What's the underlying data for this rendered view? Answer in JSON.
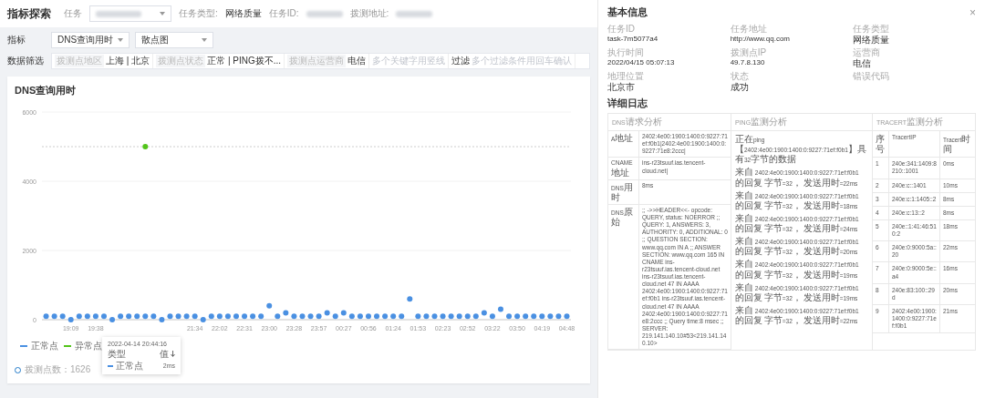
{
  "header": {
    "title": "指标探索",
    "task_label": "任务",
    "task_type_label": "任务类型:",
    "task_type": "网络质量",
    "task_id_label": "任务ID:",
    "address_label": "拨测地址:"
  },
  "metric": {
    "label": "指标",
    "metric_value": "DNS查询用时",
    "chart_type": "散点图"
  },
  "filter": {
    "label": "数据筛选",
    "items": [
      {
        "label": "拨测点地区",
        "value": "上海 | 北京"
      },
      {
        "label": "拨测点状态",
        "value": "正常 | PING拨不..."
      },
      {
        "label": "拨测点运营商",
        "value": "电信"
      },
      {
        "placeholder": "多个关键字用竖线"
      },
      {
        "label": "过滤",
        "placeholder": "多个过滤条件用回车确认"
      }
    ]
  },
  "chart": {
    "title": "DNS查询用时",
    "footer": "拨测点数：1626",
    "tooltip": {
      "time": "2022-04-14 20:44:16",
      "column_1": "类型",
      "column_2": "值",
      "rows": [
        {
          "name": "正常点",
          "value": "2ms",
          "color": "#4a90e2"
        }
      ]
    },
    "chart_data": {
      "type": "scatter",
      "categories": [
        null,
        null,
        null,
        "19:09",
        null,
        null,
        "19:38",
        null,
        null,
        null,
        null,
        null,
        null,
        null,
        null,
        null,
        null,
        null,
        "21:34",
        null,
        null,
        "22:02",
        null,
        null,
        "22:31",
        null,
        null,
        "23:00",
        null,
        null,
        "23:28",
        null,
        null,
        "23:57",
        null,
        null,
        "00:27",
        null,
        null,
        "00:56",
        null,
        null,
        "01:24",
        null,
        null,
        "01:53",
        null,
        null,
        "02:23",
        null,
        null,
        "02:52",
        null,
        null,
        "03:22",
        null,
        null,
        "03:50",
        null,
        null,
        "04:19",
        null,
        null,
        "04:48"
      ],
      "series": [
        {
          "name": "正常点",
          "color": "#4a90e2",
          "values": [
            100,
            100,
            100,
            0,
            100,
            100,
            100,
            100,
            0,
            100,
            100,
            100,
            100,
            100,
            0,
            100,
            100,
            100,
            100,
            0,
            100,
            100,
            100,
            100,
            100,
            100,
            100,
            400,
            100,
            200,
            100,
            100,
            100,
            100,
            200,
            100,
            200,
            100,
            100,
            100,
            100,
            100,
            100,
            100,
            600,
            100,
            100,
            100,
            100,
            100,
            100,
            100,
            100,
            200,
            100,
            300,
            100,
            100,
            100,
            100,
            100,
            100,
            100,
            100
          ]
        },
        {
          "name": "异常点",
          "color": "#52c41a",
          "values": [
            null,
            null,
            null,
            null,
            null,
            null,
            null,
            null,
            null,
            null,
            null,
            null,
            5000,
            null,
            null,
            null,
            null,
            null,
            null,
            null,
            null,
            null,
            null,
            null,
            null,
            null,
            null,
            null,
            null,
            null,
            null,
            null,
            null,
            null,
            null,
            null,
            null,
            null,
            null,
            null,
            null,
            null,
            null,
            null,
            null,
            null,
            null,
            null,
            null,
            null,
            null,
            null,
            null,
            null,
            null,
            null,
            null,
            null,
            null,
            null,
            null,
            null,
            null,
            null
          ]
        }
      ],
      "ylim": [
        0,
        6000
      ],
      "yticks": [
        0,
        2000,
        4000,
        6000
      ],
      "ref_lines": [
        {
          "axis": "y",
          "value": 5000
        }
      ]
    }
  },
  "drawer": {
    "title": "基本信息",
    "close": "×",
    "fields": [
      {
        "label": "任务ID",
        "value": "task-7m5077a4"
      },
      {
        "label": "任务地址",
        "value": "http://www.qq.com"
      },
      {
        "label": "任务类型",
        "value": "网络质量"
      },
      {
        "label": "执行时间",
        "value": "2022/04/15 05:07:13"
      },
      {
        "label": "拨测点IP",
        "value": "49.7.8.130"
      },
      {
        "label": "运营商",
        "value": "电信"
      },
      {
        "label": "地理位置",
        "value": "北京市"
      },
      {
        "label": "状态",
        "value": "成功"
      },
      {
        "label": "错误代码"
      }
    ],
    "log_title": "详细日志",
    "dns": {
      "header": "DNS请求分析",
      "rows": [
        {
          "label": "A地址",
          "value": "2402:4e00:1900:1400:0:9227:71ef:f0b1|2402:4e00:1900:1400:0:9227:71e8:2ccc|"
        },
        {
          "label": "CNAME地址",
          "value": "ins-r23tsuuf.ias.tencent-cloud.net|"
        },
        {
          "label": "DNS用时",
          "value": "8ms"
        },
        {
          "label": "DNS原始",
          "value": ";; ->>HEADER<<- opcode: QUERY, status: NOERROR ;; QUERY: 1, ANSWERS: 3, AUTHORITY: 0, ADDITIONAL: 0 ;; QUESTION SECTION: www.qq.com IN A ;; ANSWER SECTION: www.qq.com 165 IN CNAME ins-r23tsuuf.ias.tencent-cloud.net ins-r23tsuuf.ias.tencent-cloud.net 47 IN AAAA 2402:4e00:1900:1400:0:9227:71ef:f0b1 ins-r23tsuuf.ias.tencent-cloud.net 47 IN AAAA 2402:4e00:1900:1400:0:9227:71e8:2ccc ;; Query time:8 msec ;; SERVER: 219.141.140.10#53<219.141.140.10>"
        }
      ]
    },
    "ping": {
      "header": "PING监测分析",
      "intro": "正在ping【2402:4e00:1900:1400:0:9227:71ef:f0b1】具有32字节的数据",
      "replies": [
        "来自 2402:4e00:1900:1400:0:9227:71ef:f0b1 的回复 字节=32， 发送用时=22ms",
        "来自 2402:4e00:1900:1400:0:9227:71ef:f0b1 的回复 字节=32， 发送用时=18ms",
        "来自 2402:4e00:1900:1400:0:9227:71ef:f0b1 的回复 字节=32， 发送用时=24ms",
        "来自 2402:4e00:1900:1400:0:9227:71ef:f0b1 的回复 字节=32， 发送用时=20ms",
        "来自 2402:4e00:1900:1400:0:9227:71ef:f0b1 的回复 字节=32， 发送用时=19ms",
        "来自 2402:4e00:1900:1400:0:9227:71ef:f0b1 的回复 字节=32， 发送用时=19ms",
        "来自 2402:4e00:1900:1400:0:9227:71ef:f0b1 的回复 字节=32， 发送用时=22ms"
      ]
    },
    "tracert": {
      "header": "TRACERT监测分析",
      "columns": [
        "序号",
        "TracertIP",
        "Tracert时间"
      ],
      "rows": [
        [
          "1",
          "240e:341:1409:8210::1001",
          "0ms"
        ],
        [
          "2",
          "240e:c::1401",
          "10ms"
        ],
        [
          "3",
          "240e:c:1:1405::2",
          "8ms"
        ],
        [
          "4",
          "240e:c:13::2",
          "8ms"
        ],
        [
          "5",
          "240e::1:41:46:510:2",
          "18ms"
        ],
        [
          "6",
          "240e:0:9000:5a::20",
          "22ms"
        ],
        [
          "7",
          "240e:0:9000:5e::a4",
          "16ms"
        ],
        [
          "8",
          "240e:83:100::29d",
          "20ms"
        ],
        [
          "9",
          "2402:4e00:1900:1400:0:9227:71ef:f0b1",
          "21ms"
        ]
      ]
    }
  }
}
